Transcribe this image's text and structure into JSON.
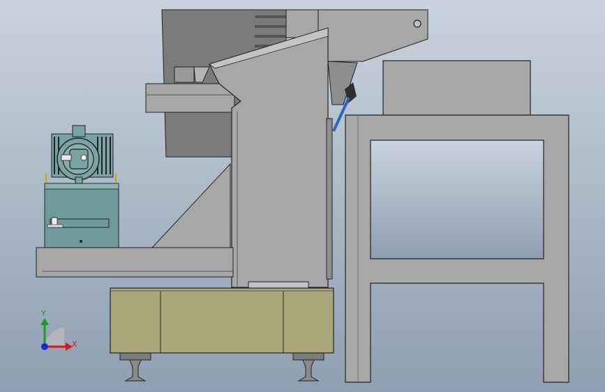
{
  "viewport": {
    "background_top": "#c9d3dd",
    "background_bottom": "#8e9fb1"
  },
  "colors": {
    "steel": "#a7a7a7",
    "steel_dark": "#8f8f8f",
    "steel_light": "#c4c4c4",
    "outline": "#222222",
    "hopper": "#7c7c7c",
    "olive_base": "#a9a77a",
    "teal_tank": "#6f9a99",
    "motor": "#7aa3a5",
    "rail": "#8a8a8a"
  },
  "triad": {
    "y_label": "Y",
    "x_label": "X",
    "y_color": "#1d9a2a",
    "x_color": "#d11a1a",
    "origin_color": "#1a2bcc"
  }
}
